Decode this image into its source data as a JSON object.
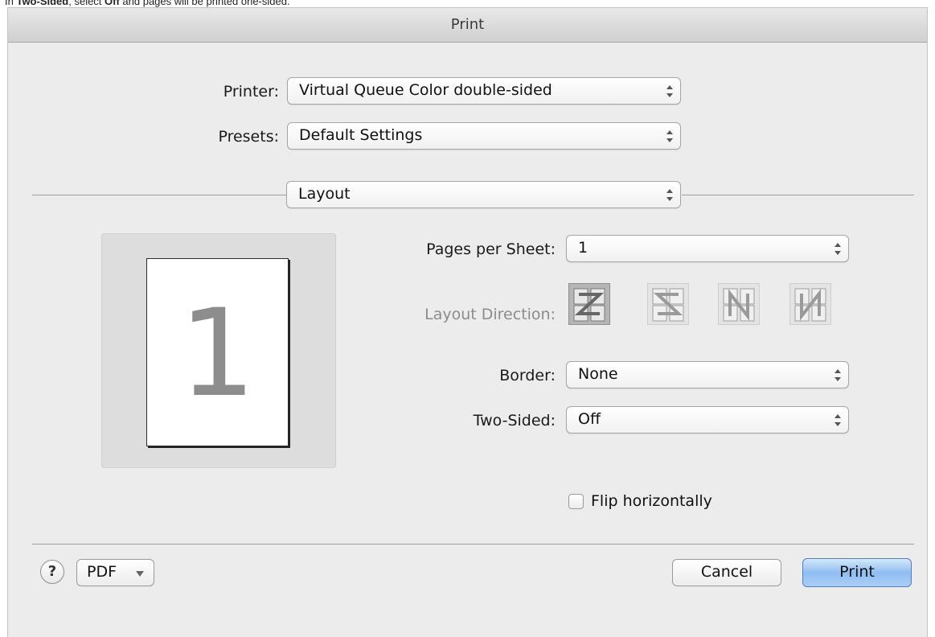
{
  "caption": {
    "prefix": "In ",
    "bold1": "Two-Sided",
    "middle": ", select ",
    "bold2": "Off",
    "suffix": " and pages will be printed one-sided."
  },
  "window": {
    "title": "Print"
  },
  "printer": {
    "label": "Printer:",
    "value": "Virtual Queue Color double-sided"
  },
  "presets": {
    "label": "Presets:",
    "value": "Default Settings"
  },
  "section": {
    "value": "Layout"
  },
  "preview": {
    "page_number": "1"
  },
  "layout": {
    "pages_per_sheet": {
      "label": "Pages per Sheet:",
      "value": "1"
    },
    "layout_direction": {
      "label": "Layout Direction:",
      "options": [
        "Z-left-to-right",
        "S-right-to-left",
        "N-top-to-bottom",
        "N-reverse"
      ],
      "selected_index": 0
    },
    "border": {
      "label": "Border:",
      "value": "None"
    },
    "two_sided": {
      "label": "Two-Sided:",
      "value": "Off"
    },
    "flip": {
      "label": "Flip horizontally",
      "checked": false
    }
  },
  "footer": {
    "help": "?",
    "pdf": "PDF",
    "cancel": "Cancel",
    "print": "Print"
  },
  "colors": {
    "accent": "#8fbdf0",
    "dialog_bg": "#ececec"
  }
}
